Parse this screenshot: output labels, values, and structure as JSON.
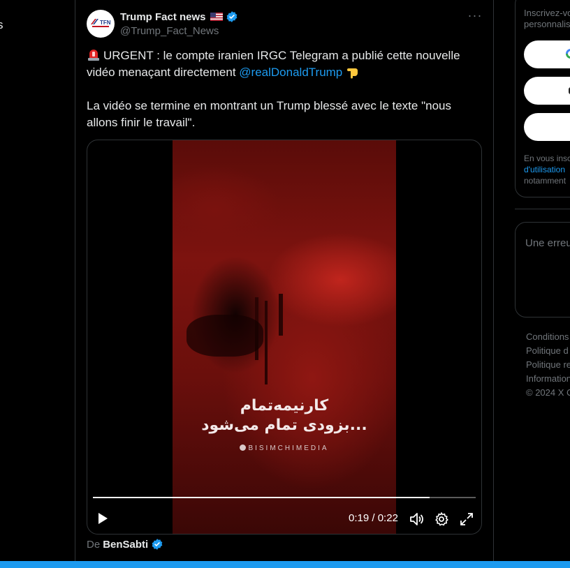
{
  "left_nav": {
    "edge_char": "s"
  },
  "tweet": {
    "display_name": "Trump Fact news",
    "handle": "@Trump_Fact_News",
    "avatar_text": "TFN",
    "more_label": "···",
    "text_line1_prefix": "URGENT : le compte iranien IRGC Telegram a publié cette nouvelle vidéo menaçant directement ",
    "mention": "@realDonaldTrump",
    "text_paragraph2": "La vidéo se termine en montrant un Trump blessé avec le texte \"nous allons finir le travail\".",
    "from_prefix": "De",
    "from_name": "BenSabti"
  },
  "video": {
    "overlay_line1": "کارنیمه‌تمام",
    "overlay_line2": "بزودی تمام می‌شود...",
    "watermark": "BISIMCHIMEDIA",
    "time_current": "0:19",
    "time_separator": "/",
    "time_total": "0:22",
    "progress_fraction": 0.88
  },
  "right_column": {
    "signup_text_line1": "Inscrivez-vo",
    "signup_text_line2": "personnalisé",
    "legal_line1": "En vous insc",
    "legal_link": "d'utilisation",
    "legal_line3": "notamment",
    "error_text": "Une erreur",
    "footer_links": [
      "Conditions",
      "Politique d",
      "Politique re",
      "Information",
      "© 2024 X C"
    ]
  },
  "colors": {
    "accent": "#1d9bf0",
    "text_primary": "#e7e9ea",
    "text_secondary": "#71767b",
    "border": "#2f3336"
  }
}
